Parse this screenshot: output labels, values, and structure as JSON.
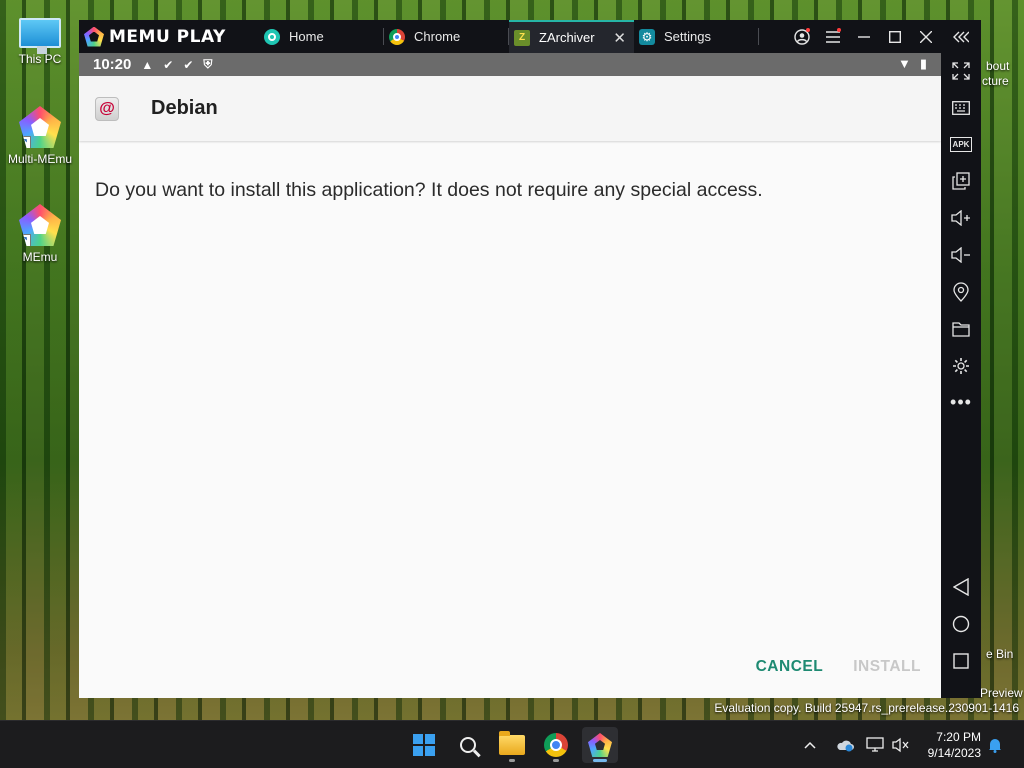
{
  "desktop": {
    "icons": [
      {
        "label": "This PC"
      },
      {
        "label": "Multi-MEmu"
      },
      {
        "label": "MEmu"
      }
    ],
    "partial_right_labels": {
      "about_line1": "bout",
      "about_line2": "cture",
      "recycle": "e Bin",
      "preview": "Preview"
    },
    "watermark": "Evaluation copy. Build 25947.rs_prerelease.230901-1416"
  },
  "emulator": {
    "brand": "MEMU PLAY",
    "tabs": [
      {
        "label": "Home",
        "icon": "home-icon"
      },
      {
        "label": "Chrome",
        "icon": "chrome-icon"
      },
      {
        "label": "ZArchiver",
        "icon": "zarchiver-icon",
        "active": true
      },
      {
        "label": "Settings",
        "icon": "settings-icon"
      }
    ],
    "window_controls": [
      "account-icon",
      "menu-icon",
      "minimize-icon",
      "maximize-icon",
      "close-icon",
      "collapse-icon"
    ],
    "status_bar": {
      "time": "10:20"
    },
    "installer": {
      "app_name": "Debian",
      "message": "Do you want to install this application? It does not require any special access.",
      "cancel_label": "CANCEL",
      "install_label": "INSTALL"
    },
    "sidebar_tools": [
      "fullscreen-icon",
      "keyboard-icon",
      "apk-icon",
      "multi-window-icon",
      "volume-up-icon",
      "volume-down-icon",
      "location-icon",
      "folder-icon",
      "settings-icon",
      "more-icon",
      "back-icon",
      "home-circle-icon",
      "recents-icon"
    ],
    "sidebar_apk_text": "APK"
  },
  "taskbar": {
    "clock_time": "7:20 PM",
    "clock_date": "9/14/2023"
  },
  "colors": {
    "accent_teal": "#26b5a6",
    "cancel_green": "#1e8a72",
    "install_disabled": "#c8c8c8"
  }
}
